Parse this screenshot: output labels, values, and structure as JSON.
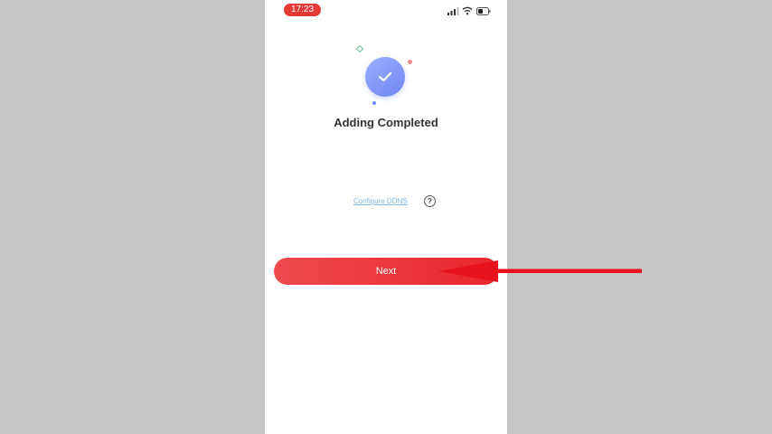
{
  "status_bar": {
    "time": "17:23",
    "icons": [
      "signal-icon",
      "wifi-icon",
      "battery-icon"
    ]
  },
  "result": {
    "icon": "check-circle-icon",
    "title": "Adding Completed"
  },
  "ddns": {
    "link_label": "Configure DDNS",
    "help_icon": "?"
  },
  "primary_action": {
    "label": "Next"
  },
  "colors": {
    "accent_red": "#e8262e",
    "success_blue": "#6f86f0",
    "link_blue": "#7fb7e6",
    "background_gray": "#c6c6c6"
  }
}
